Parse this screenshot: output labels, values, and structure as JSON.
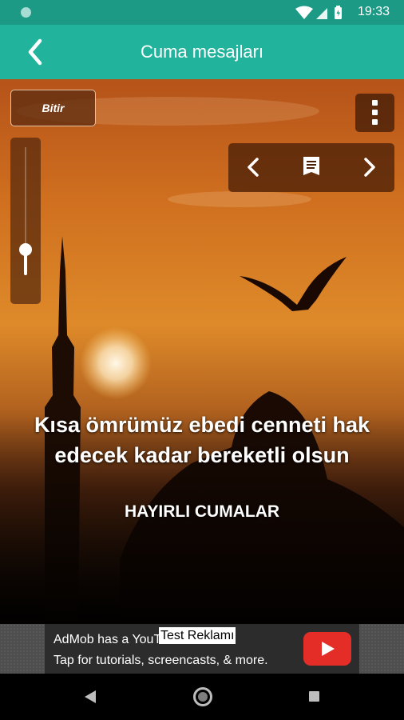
{
  "status_bar": {
    "time": "19:33",
    "icons": [
      "notification-dot-icon",
      "wifi-icon",
      "signal-icon",
      "battery-charging-icon"
    ]
  },
  "app_bar": {
    "title": "Cuma mesajları",
    "back_icon": "chevron-left-icon"
  },
  "controls": {
    "finish_label": "Bitir",
    "menu_icon": "more-vertical-icon",
    "nav_icons": [
      "chevron-left-icon",
      "document-icon",
      "chevron-right-icon"
    ],
    "slider_level": 0.2
  },
  "message": {
    "quote": "Kısa ömrümüz ebedi cenneti hak edecek kadar bereketli olsun",
    "subtitle": "HAYIRLI CUMALAR"
  },
  "ad": {
    "line1": "AdMob has a YouTube Channel",
    "line2": "Tap for tutorials, screencasts, & more.",
    "tag": "Test Reklamı",
    "icon": "youtube-play-icon"
  },
  "colors": {
    "status": "#1c9a86",
    "appbar": "#22b39c",
    "sky_top": "#b5531a",
    "sky_mid": "#de8a2a"
  },
  "navbar": {
    "icons": [
      "back-triangle-icon",
      "home-circle-icon",
      "recents-square-icon"
    ]
  }
}
